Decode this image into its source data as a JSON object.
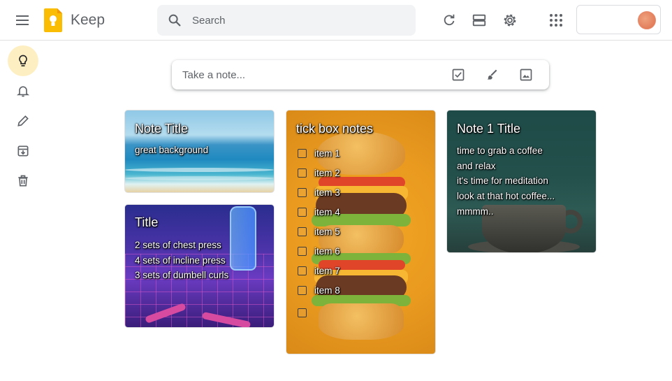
{
  "app": {
    "title": "Keep",
    "brand_color": "#fbbc04"
  },
  "search": {
    "placeholder": "Search"
  },
  "header_icons": [
    "menu-icon",
    "refresh-icon",
    "list-view-icon",
    "settings-icon",
    "apps-icon"
  ],
  "sidebar": {
    "items": [
      {
        "icon": "lightbulb-icon",
        "active": true
      },
      {
        "icon": "bell-icon",
        "active": false
      },
      {
        "icon": "pencil-icon",
        "active": false
      },
      {
        "icon": "archive-icon",
        "active": false
      },
      {
        "icon": "trash-icon",
        "active": false
      }
    ],
    "active_color": "#feefc3"
  },
  "take_note": {
    "placeholder": "Take a note...",
    "icons": [
      "checkbox-icon",
      "brush-icon",
      "image-icon"
    ]
  },
  "notes": [
    {
      "title": "Note Title",
      "lines": [
        "great background"
      ],
      "background": "ocean"
    },
    {
      "title": "Title",
      "lines": [
        "2 sets of chest press",
        "4 sets of incline press",
        "3 sets of dumbell curls"
      ],
      "background": "fitness"
    },
    {
      "title": "tick box notes",
      "items": [
        "item 1",
        "item 2",
        "item 3",
        "item 4",
        "item 5",
        "item 6",
        "item 7",
        "item 8",
        ""
      ],
      "background": "burger"
    },
    {
      "title": "Note 1 Title",
      "lines": [
        "time to grab a coffee",
        "and relax",
        "it's time for meditation",
        "look at that hot coffee...",
        "mmmm.."
      ],
      "background": "coffee"
    }
  ]
}
